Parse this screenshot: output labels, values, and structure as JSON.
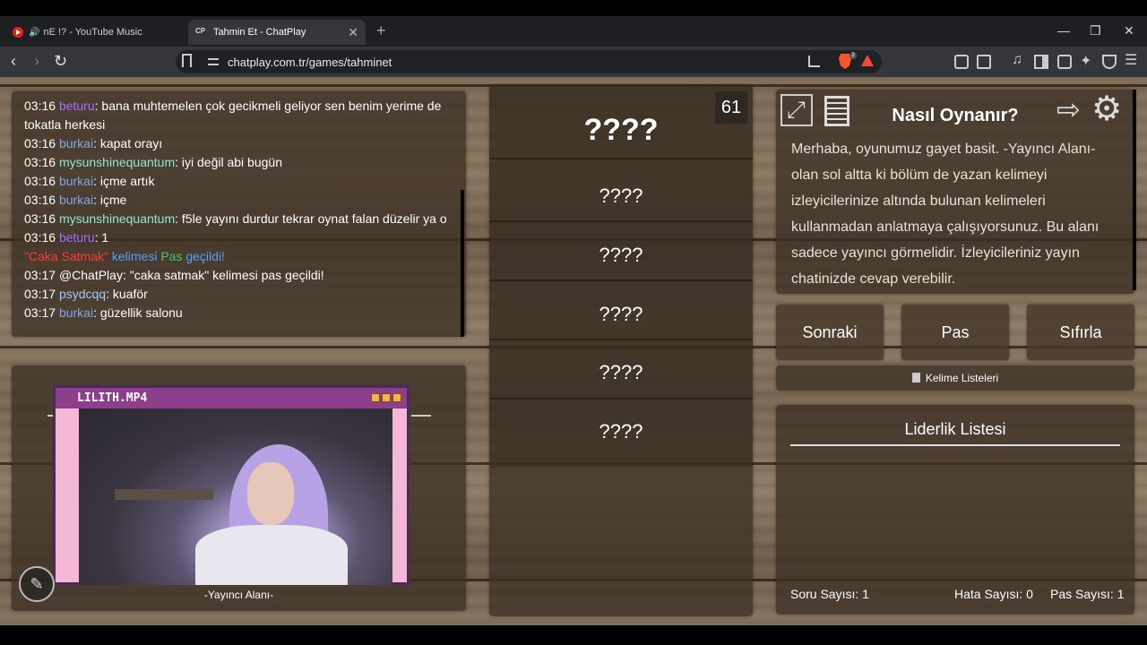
{
  "browser": {
    "tabs": [
      {
        "title": "nE !? - YouTube Music",
        "icon": "youtube-music-icon"
      },
      {
        "title": "Tahmin Et - ChatPlay",
        "icon": "chatplay-icon",
        "favicon_text": "CP"
      }
    ],
    "url": "chatplay.com.tr/games/tahminet",
    "rewards_badge": "2"
  },
  "chat": {
    "messages": [
      {
        "time": "03:16",
        "user": "beturu",
        "color": "purple",
        "text": "bana muhtemelen çok gecikmeli geliyor sen benim yerime de tokatla herkesi"
      },
      {
        "time": "03:16",
        "user": "burkai",
        "color": "blue",
        "text": "kapat orayı"
      },
      {
        "time": "03:16",
        "user": "mysunshinequantum",
        "color": "teal",
        "text": "iyi değil abi bugün"
      },
      {
        "time": "03:16",
        "user": "burkai",
        "color": "blue",
        "text": "içme artık"
      },
      {
        "time": "03:16",
        "user": "burkai",
        "color": "blue",
        "text": "içme"
      },
      {
        "time": "03:16",
        "user": "mysunshinequantum",
        "color": "teal",
        "text": "f5le yayını durdur tekrar oynat falan düzelir ya o"
      },
      {
        "time": "03:16",
        "user": "beturu",
        "color": "purple",
        "text": "1"
      }
    ],
    "system": {
      "word": "\"Caka Satmak\"",
      "mid": " kelimesi ",
      "pas": "Pas",
      "end": " geçildi!"
    },
    "bot": {
      "time": "03:17",
      "text": "@ChatPlay: \"caka satmak\" kelimesi pas geçildi!"
    },
    "after": [
      {
        "time": "03:17",
        "user": "psydcqq",
        "color": "lightblue",
        "text": "kuaför"
      },
      {
        "time": "03:17",
        "user": "burkai",
        "color": "blue",
        "text": "güzellik salonu"
      }
    ]
  },
  "streamer": {
    "overlay_title": "LILITH.MP4",
    "caption": "-Yayıncı Alanı-"
  },
  "game": {
    "timer": "61",
    "main_word": "????",
    "words": [
      "????",
      "????",
      "????",
      "????",
      "????"
    ]
  },
  "help": {
    "title": "Nasıl Oynanır?",
    "text": "Merhaba, oyunumuz gayet basit. -Yayıncı Alanı- olan sol altta ki bölüm de yazan kelimeyi izleyicilerinize altında bulunan kelimeleri kullanmadan anlatmaya çalışıyorsunuz. Bu alanı sadece yayıncı görmelidir. İzleyicileriniz yayın chatinizde cevap verebilir."
  },
  "actions": {
    "next": "Sonraki",
    "pass": "Pas",
    "reset": "Sıfırla",
    "word_lists": "Kelime Listeleri"
  },
  "leaderboard": {
    "title": "Liderlik Listesi",
    "questions": "Soru Sayısı: 1",
    "errors": "Hata Sayısı: 0",
    "passes": "Pas Sayısı: 1"
  }
}
